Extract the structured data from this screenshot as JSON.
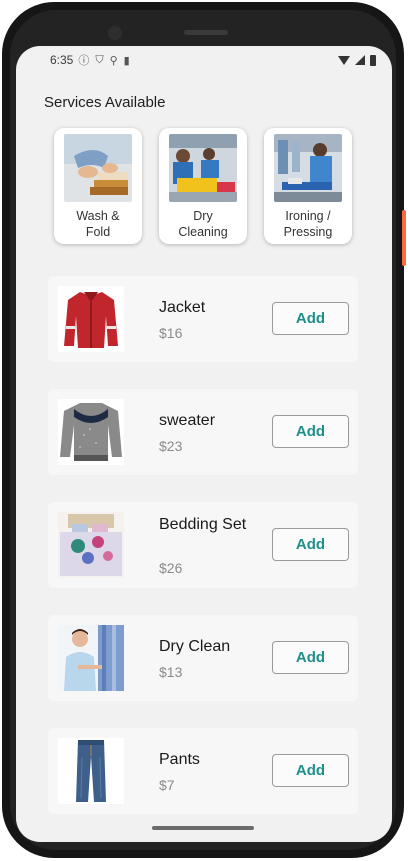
{
  "status_bar": {
    "time": "6:35",
    "icons": [
      "info-icon",
      "shield-icon",
      "usb-icon",
      "sd-card-icon"
    ],
    "right_icons": [
      "wifi-icon",
      "cell-signal-icon",
      "battery-icon"
    ]
  },
  "heading": "Services Available",
  "services": [
    {
      "label": "Wash &\nFold",
      "image": "folding-laundry-photo"
    },
    {
      "label": "Dry\nCleaning",
      "image": "dry-cleaning-workers-photo"
    },
    {
      "label": "Ironing /\nPressing",
      "image": "ironing-worker-photo"
    }
  ],
  "items": [
    {
      "name": "Jacket",
      "price": "$16",
      "button": "Add",
      "image": "red-jacket"
    },
    {
      "name": "sweater",
      "price": "$23",
      "button": "Add",
      "image": "gray-sweater"
    },
    {
      "name": "Bedding Set",
      "price": "$26",
      "button": "Add",
      "image": "floral-bedding"
    },
    {
      "name": "Dry Clean",
      "price": "$13",
      "button": "Add",
      "image": "dry-clean-woman"
    },
    {
      "name": "Pants",
      "price": "$7",
      "button": "Add",
      "image": "blue-jeans"
    }
  ],
  "colors": {
    "accent": "#1f8f8a",
    "screen_bg": "#f1f1f1",
    "card_bg": "#f7f7f7"
  }
}
